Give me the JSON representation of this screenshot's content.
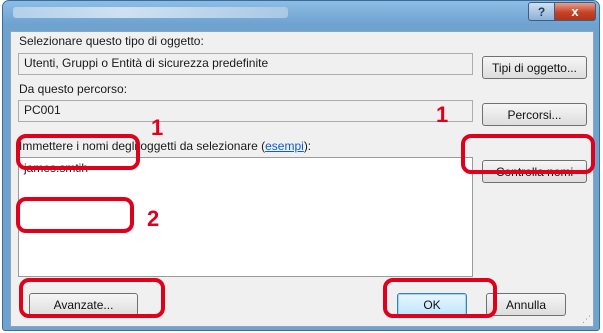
{
  "window": {
    "help_glyph": "?",
    "close_glyph": "x"
  },
  "object_type": {
    "label": "Selezionare questo tipo di oggetto:",
    "value": "Utenti, Gruppi o Entità di sicurezza predefinite",
    "button": "Tipi di oggetto..."
  },
  "location": {
    "label": "Da questo percorso:",
    "value": "PC001",
    "button": "Percorsi..."
  },
  "names": {
    "label_text": "Immettere i nomi degli oggetti da selezionare (",
    "link": "esempi",
    "label_suffix": "):",
    "value": "james.smtih",
    "button": "Controlla nomi"
  },
  "footer": {
    "advanced": "Avanzate...",
    "ok": "OK",
    "cancel": "Annulla"
  },
  "annotations": {
    "colors": {
      "highlight": "#e0001b"
    },
    "labels": [
      "1",
      "1",
      "2"
    ]
  }
}
